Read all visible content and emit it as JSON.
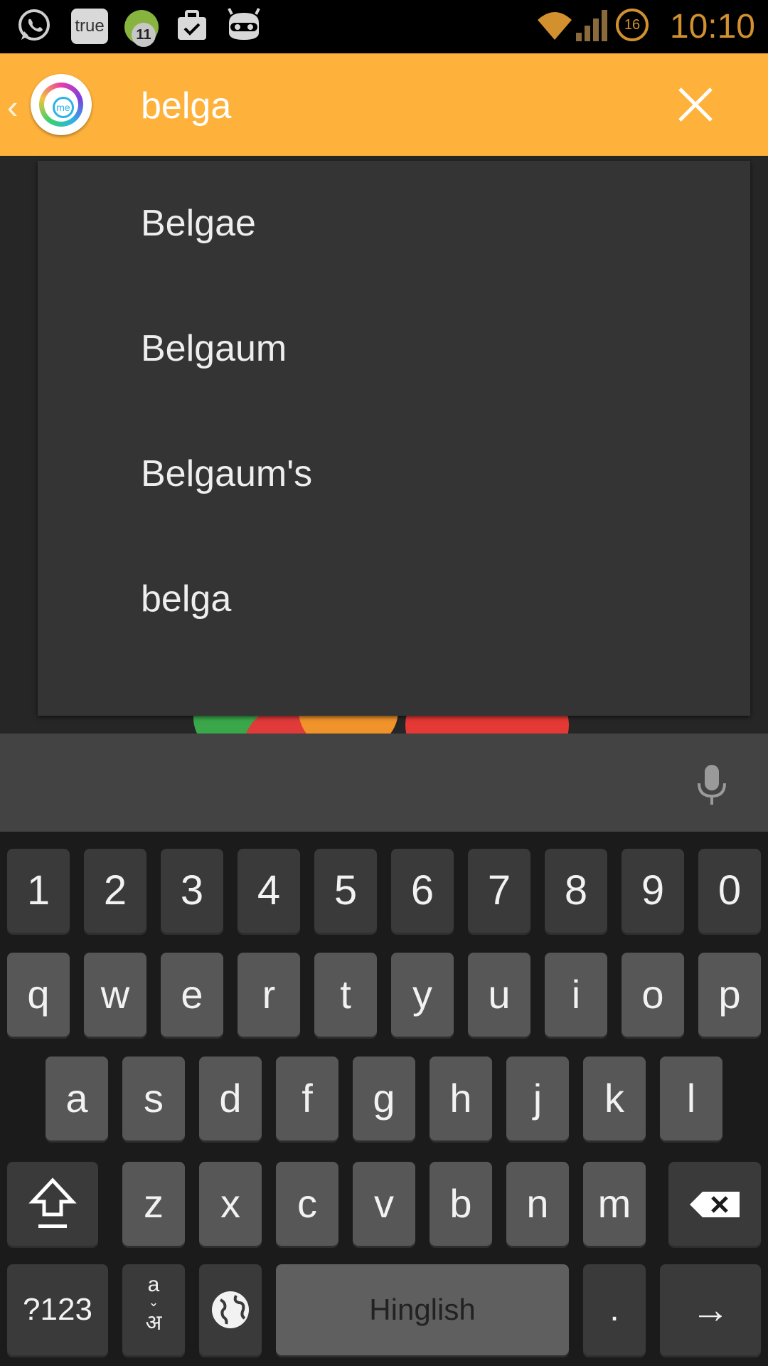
{
  "status_bar": {
    "time": "10:10",
    "notification_true_label": "true",
    "notification_count": "11",
    "battery_level": "16"
  },
  "app_bar": {
    "logo_text": "me",
    "search": {
      "value": "belga"
    }
  },
  "suggestions": [
    "Belgae",
    "Belgaum",
    "Belgaum's",
    "belga"
  ],
  "keyboard": {
    "number_row": [
      "1",
      "2",
      "3",
      "4",
      "5",
      "6",
      "7",
      "8",
      "9",
      "0"
    ],
    "row1": [
      "q",
      "w",
      "e",
      "r",
      "t",
      "y",
      "u",
      "i",
      "o",
      "p"
    ],
    "row2": [
      "a",
      "s",
      "d",
      "f",
      "g",
      "h",
      "j",
      "k",
      "l"
    ],
    "row3": [
      "z",
      "x",
      "c",
      "v",
      "b",
      "n",
      "m"
    ],
    "symbols_label": "?123",
    "lang_switch_top": "a",
    "lang_switch_bottom": "अ",
    "space_label": "Hinglish",
    "period_label": ".",
    "enter_label": "→"
  },
  "colors": {
    "accent": "#ffb23b",
    "status_text": "#d2902f",
    "dropdown_bg": "#343434"
  }
}
